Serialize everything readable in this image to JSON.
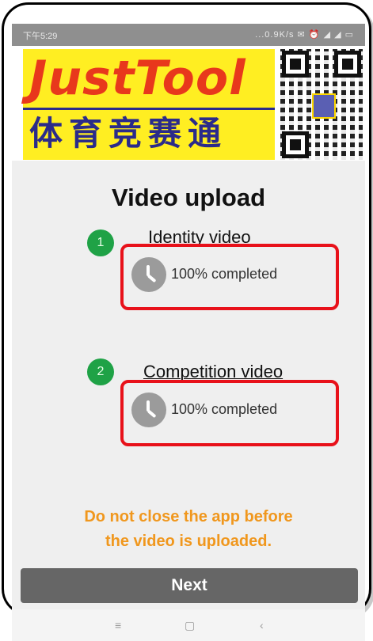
{
  "statusbar": {
    "time": "下午5:29",
    "indicators": "...0.9K/s ✉ ⏰ ◢ ◢ ▭"
  },
  "banner": {
    "logo_text": "JustTool",
    "logo_cn": "体育竞赛通",
    "qr_icon": "qr-code-icon"
  },
  "page": {
    "title": "Video upload"
  },
  "steps": [
    {
      "number": "1",
      "title": "Identity video",
      "progress_text": "100% completed",
      "progress": 1.0
    },
    {
      "number": "2",
      "title": "Competition video",
      "progress_text": "100% completed",
      "progress": 1.0
    }
  ],
  "warning": {
    "line1": "Do not close the app before",
    "line2": "the video is uploaded."
  },
  "buttons": {
    "next": "Next"
  },
  "navbar": {
    "menu": "≡",
    "home": "▢",
    "back": "‹"
  },
  "colors": {
    "step_green": "#1fa246",
    "highlight_red": "#e8111a",
    "warning_orange": "#f0971d",
    "button_gray": "#666666"
  }
}
